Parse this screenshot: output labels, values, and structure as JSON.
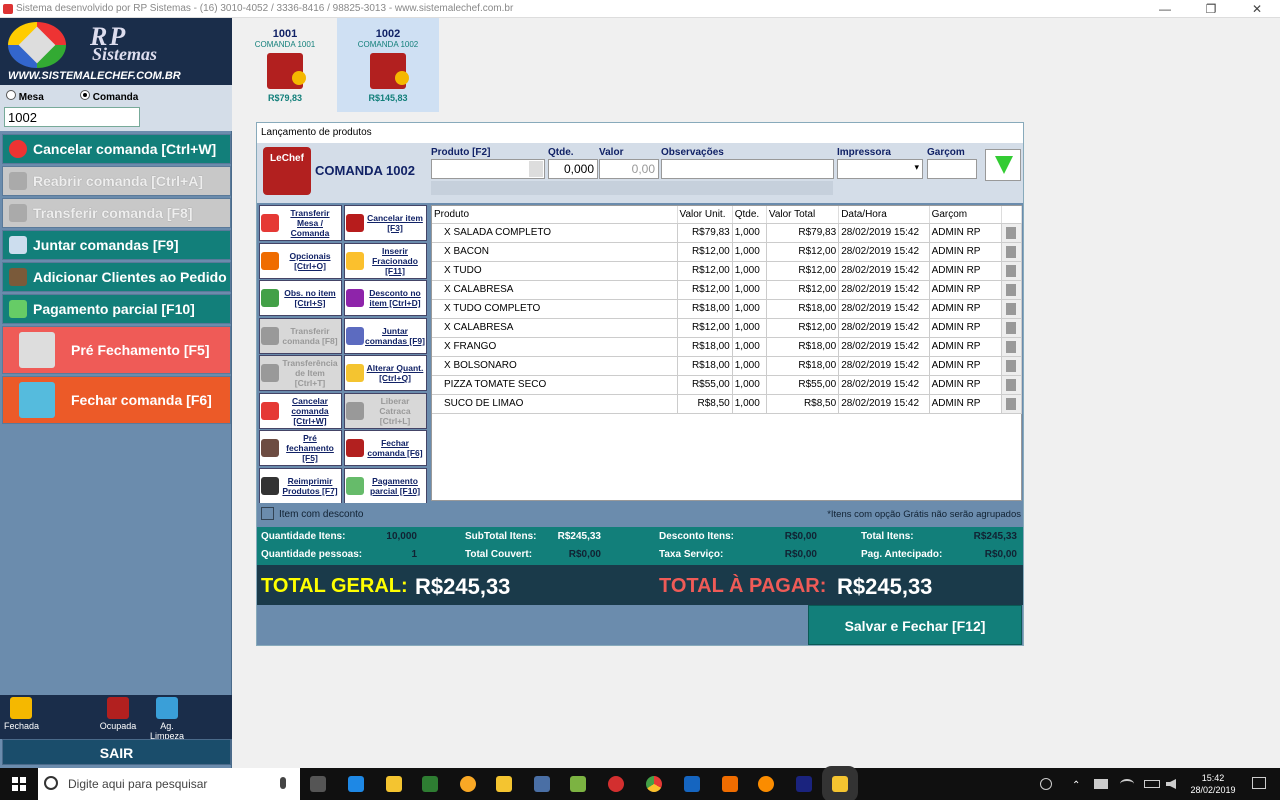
{
  "window": {
    "title": "Sistema desenvolvido por RP Sistemas - (16) 3010-4052 / 3336-8416 / 98825-3013 - www.sistemalechef.com.br",
    "min": "—",
    "max": "❐",
    "close": "✕"
  },
  "logo": {
    "line1": "RP",
    "line2": "Sistemas",
    "url": "WWW.SISTEMALECHEF.COM.BR"
  },
  "mode": {
    "mesa": "Mesa",
    "comanda": "Comanda",
    "selected": "Comanda",
    "value": "1002"
  },
  "sidebar": {
    "buttons": [
      {
        "label": "Cancelar comanda [Ctrl+W]"
      },
      {
        "label": "Reabrir comanda [Ctrl+A]"
      },
      {
        "label": "Transferir comanda [F8]"
      },
      {
        "label": "Juntar comandas [F9]"
      },
      {
        "label": "Adicionar Clientes ao Pedido"
      },
      {
        "label": "Pagamento parcial [F10]"
      },
      {
        "label": "Pré Fechamento [F5]"
      },
      {
        "label": "Fechar comanda [F6]"
      }
    ],
    "legend": [
      "Fechada",
      "Ocupada",
      "Ag. Limpeza"
    ],
    "exit": "SAIR"
  },
  "comandas": [
    {
      "num": "1001",
      "label": "COMANDA 1001",
      "value": "R$79,83"
    },
    {
      "num": "1002",
      "label": "COMANDA 1002",
      "value": "R$145,83"
    }
  ],
  "dialog": {
    "title": "Lançamento de produtos",
    "comanda": "COMANDA 1002",
    "badge": "LeChef",
    "fields": {
      "produto": "Produto [F2]",
      "qtde": "Qtde.",
      "qtde_val": "0,000",
      "valor": "Valor",
      "valor_val": "0,00",
      "obs": "Observações",
      "impressora": "Impressora",
      "garcom": "Garçom"
    },
    "actions": [
      {
        "label": "Transferir Mesa / Comanda"
      },
      {
        "label": "Cancelar item [F3]"
      },
      {
        "label": "Opcionais [Ctrl+O]"
      },
      {
        "label": "Inserir Fracionado [F11]"
      },
      {
        "label": "Obs. no item [Ctrl+S]"
      },
      {
        "label": "Desconto no item [Ctrl+D]"
      },
      {
        "label": "Transferir comanda [F8]"
      },
      {
        "label": "Juntar comandas [F9]"
      },
      {
        "label": "Transferência de Item [Ctrl+T]"
      },
      {
        "label": "Alterar Quant. [Ctrl+Q]"
      },
      {
        "label": "Cancelar comanda [Ctrl+W]"
      },
      {
        "label": "Liberar Catraca [Ctrl+L]"
      },
      {
        "label": "Pré fechamento [F5]"
      },
      {
        "label": "Fechar comanda [F6]"
      },
      {
        "label": "Reimprimir Produtos [F7]"
      },
      {
        "label": "Pagamento parcial [F10]"
      }
    ],
    "columns": [
      "Produto",
      "Valor Unit.",
      "Qtde.",
      "Valor Total",
      "Data/Hora",
      "Garçom"
    ],
    "rows": [
      [
        "X SALADA COMPLETO",
        "R$79,83",
        "1,000",
        "R$79,83",
        "28/02/2019 15:42",
        "ADMIN RP"
      ],
      [
        "X BACON",
        "R$12,00",
        "1,000",
        "R$12,00",
        "28/02/2019 15:42",
        "ADMIN RP"
      ],
      [
        "X TUDO",
        "R$12,00",
        "1,000",
        "R$12,00",
        "28/02/2019 15:42",
        "ADMIN RP"
      ],
      [
        "X CALABRESA",
        "R$12,00",
        "1,000",
        "R$12,00",
        "28/02/2019 15:42",
        "ADMIN RP"
      ],
      [
        "X TUDO COMPLETO",
        "R$18,00",
        "1,000",
        "R$18,00",
        "28/02/2019 15:42",
        "ADMIN RP"
      ],
      [
        "X CALABRESA",
        "R$12,00",
        "1,000",
        "R$12,00",
        "28/02/2019 15:42",
        "ADMIN RP"
      ],
      [
        "X FRANGO",
        "R$18,00",
        "1,000",
        "R$18,00",
        "28/02/2019 15:42",
        "ADMIN RP"
      ],
      [
        "X BOLSONARO",
        "R$18,00",
        "1,000",
        "R$18,00",
        "28/02/2019 15:42",
        "ADMIN RP"
      ],
      [
        "PIZZA TOMATE SECO",
        "R$55,00",
        "1,000",
        "R$55,00",
        "28/02/2019 15:42",
        "ADMIN RP"
      ],
      [
        "SUCO DE LIMAO",
        "R$8,50",
        "1,000",
        "R$8,50",
        "28/02/2019 15:42",
        "ADMIN RP"
      ]
    ],
    "discount_check": "Item com desconto",
    "note": "*Itens com opção Grátis não serão agrupados",
    "totals": {
      "qtd_itens_l": "Quantidade Itens:",
      "qtd_itens": "10,000",
      "subtotal_l": "SubTotal Itens:",
      "subtotal": "R$245,33",
      "desc_l": "Desconto Itens:",
      "desc": "R$0,00",
      "total_itens_l": "Total Itens:",
      "total_itens": "R$245,33",
      "pessoas_l": "Quantidade pessoas:",
      "pessoas": "1",
      "couvert_l": "Total Couvert:",
      "couvert": "R$0,00",
      "taxa_l": "Taxa Serviço:",
      "taxa": "R$0,00",
      "antecipado_l": "Pag. Antecipado:",
      "antecipado": "R$0,00"
    },
    "total_geral_l": "TOTAL GERAL:",
    "total_geral": "R$245,33",
    "total_pagar_l": "TOTAL À PAGAR:",
    "total_pagar": "R$245,33",
    "save": "Salvar e Fechar [F12]"
  },
  "taskbar": {
    "search": "Digite aqui para pesquisar",
    "time": "15:42",
    "date": "28/02/2019"
  },
  "colors": {
    "teal": "#127f7a",
    "sidebar": "#6b8cad",
    "red": "#ef5b57",
    "orange": "#ec5a28"
  }
}
